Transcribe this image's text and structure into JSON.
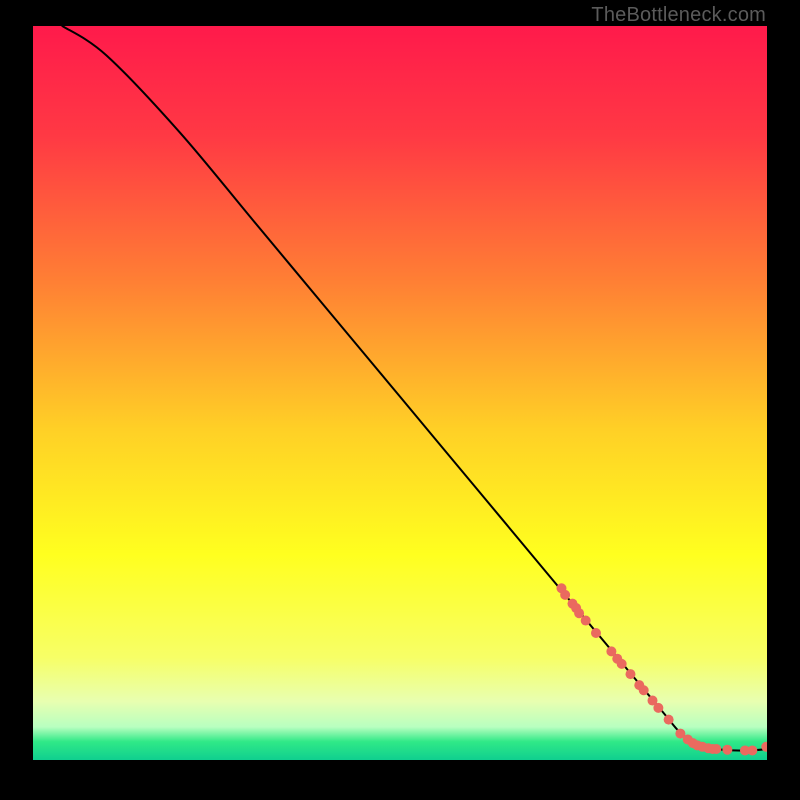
{
  "watermark": "TheBottleneck.com",
  "chart_data": {
    "type": "line",
    "title": "",
    "xlabel": "",
    "ylabel": "",
    "xlim": [
      0,
      100
    ],
    "ylim": [
      0,
      100
    ],
    "gradient_stops": [
      {
        "offset": 0.0,
        "color": "#ff1a4b"
      },
      {
        "offset": 0.15,
        "color": "#ff3944"
      },
      {
        "offset": 0.35,
        "color": "#ff8034"
      },
      {
        "offset": 0.55,
        "color": "#ffd026"
      },
      {
        "offset": 0.72,
        "color": "#ffff1f"
      },
      {
        "offset": 0.86,
        "color": "#f7ff66"
      },
      {
        "offset": 0.92,
        "color": "#e8ffb0"
      },
      {
        "offset": 0.955,
        "color": "#b8ffc0"
      },
      {
        "offset": 0.975,
        "color": "#30e987"
      },
      {
        "offset": 1.0,
        "color": "#0fcf8f"
      }
    ],
    "series": [
      {
        "name": "bottleneck-curve",
        "x": [
          4,
          10,
          20,
          30,
          40,
          50,
          60,
          70,
          74,
          78,
          82,
          86,
          88,
          90,
          92,
          94,
          96,
          98,
          100
        ],
        "y": [
          100,
          96,
          85.5,
          73.5,
          61.5,
          49.5,
          37.5,
          25.5,
          20.7,
          15.9,
          11.1,
          6.3,
          3.9,
          2.4,
          1.7,
          1.4,
          1.3,
          1.3,
          1.5
        ]
      }
    ],
    "markers": {
      "name": "highlighted-points",
      "color": "#ea6a5f",
      "points": [
        {
          "x": 72.0,
          "y": 23.4,
          "r": 5
        },
        {
          "x": 72.5,
          "y": 22.5,
          "r": 5
        },
        {
          "x": 73.5,
          "y": 21.3,
          "r": 5
        },
        {
          "x": 74.0,
          "y": 20.7,
          "r": 5
        },
        {
          "x": 74.4,
          "y": 20.0,
          "r": 5
        },
        {
          "x": 75.3,
          "y": 19.0,
          "r": 5
        },
        {
          "x": 76.7,
          "y": 17.3,
          "r": 5
        },
        {
          "x": 78.8,
          "y": 14.8,
          "r": 5
        },
        {
          "x": 79.6,
          "y": 13.8,
          "r": 5
        },
        {
          "x": 80.2,
          "y": 13.1,
          "r": 5
        },
        {
          "x": 81.4,
          "y": 11.7,
          "r": 5
        },
        {
          "x": 82.6,
          "y": 10.2,
          "r": 5
        },
        {
          "x": 83.2,
          "y": 9.5,
          "r": 5
        },
        {
          "x": 84.4,
          "y": 8.1,
          "r": 5
        },
        {
          "x": 85.2,
          "y": 7.1,
          "r": 5
        },
        {
          "x": 86.6,
          "y": 5.5,
          "r": 5
        },
        {
          "x": 88.2,
          "y": 3.6,
          "r": 5
        },
        {
          "x": 89.2,
          "y": 2.8,
          "r": 5
        },
        {
          "x": 89.9,
          "y": 2.3,
          "r": 5
        },
        {
          "x": 90.5,
          "y": 2.0,
          "r": 5
        },
        {
          "x": 91.2,
          "y": 1.8,
          "r": 5
        },
        {
          "x": 92.0,
          "y": 1.6,
          "r": 5
        },
        {
          "x": 92.6,
          "y": 1.5,
          "r": 5
        },
        {
          "x": 93.1,
          "y": 1.5,
          "r": 5
        },
        {
          "x": 94.6,
          "y": 1.4,
          "r": 5
        },
        {
          "x": 97.0,
          "y": 1.3,
          "r": 5
        },
        {
          "x": 98.0,
          "y": 1.3,
          "r": 5
        },
        {
          "x": 99.9,
          "y": 1.8,
          "r": 5
        }
      ]
    }
  }
}
